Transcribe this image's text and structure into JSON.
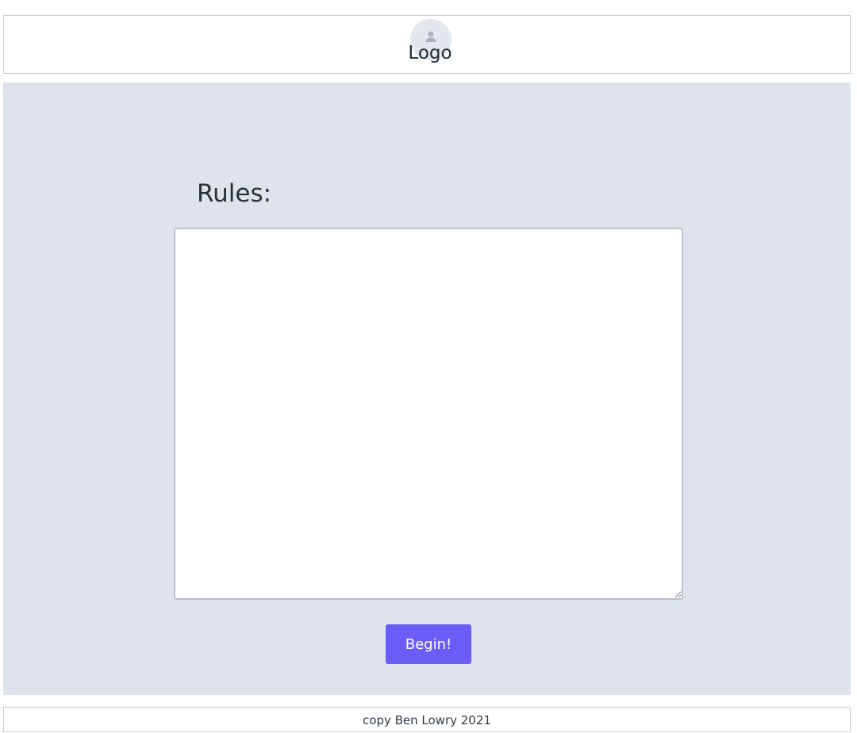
{
  "header": {
    "logo_text": "Logo",
    "avatar_icon": "person-icon"
  },
  "main": {
    "heading": "Rules:",
    "rules_value": "",
    "begin_label": "Begin!"
  },
  "footer": {
    "copyright": "copy Ben Lowry 2021"
  },
  "colors": {
    "accent": "#6c5cf6",
    "main_bg": "#dfe4ec",
    "border": "#c4ccd4"
  }
}
